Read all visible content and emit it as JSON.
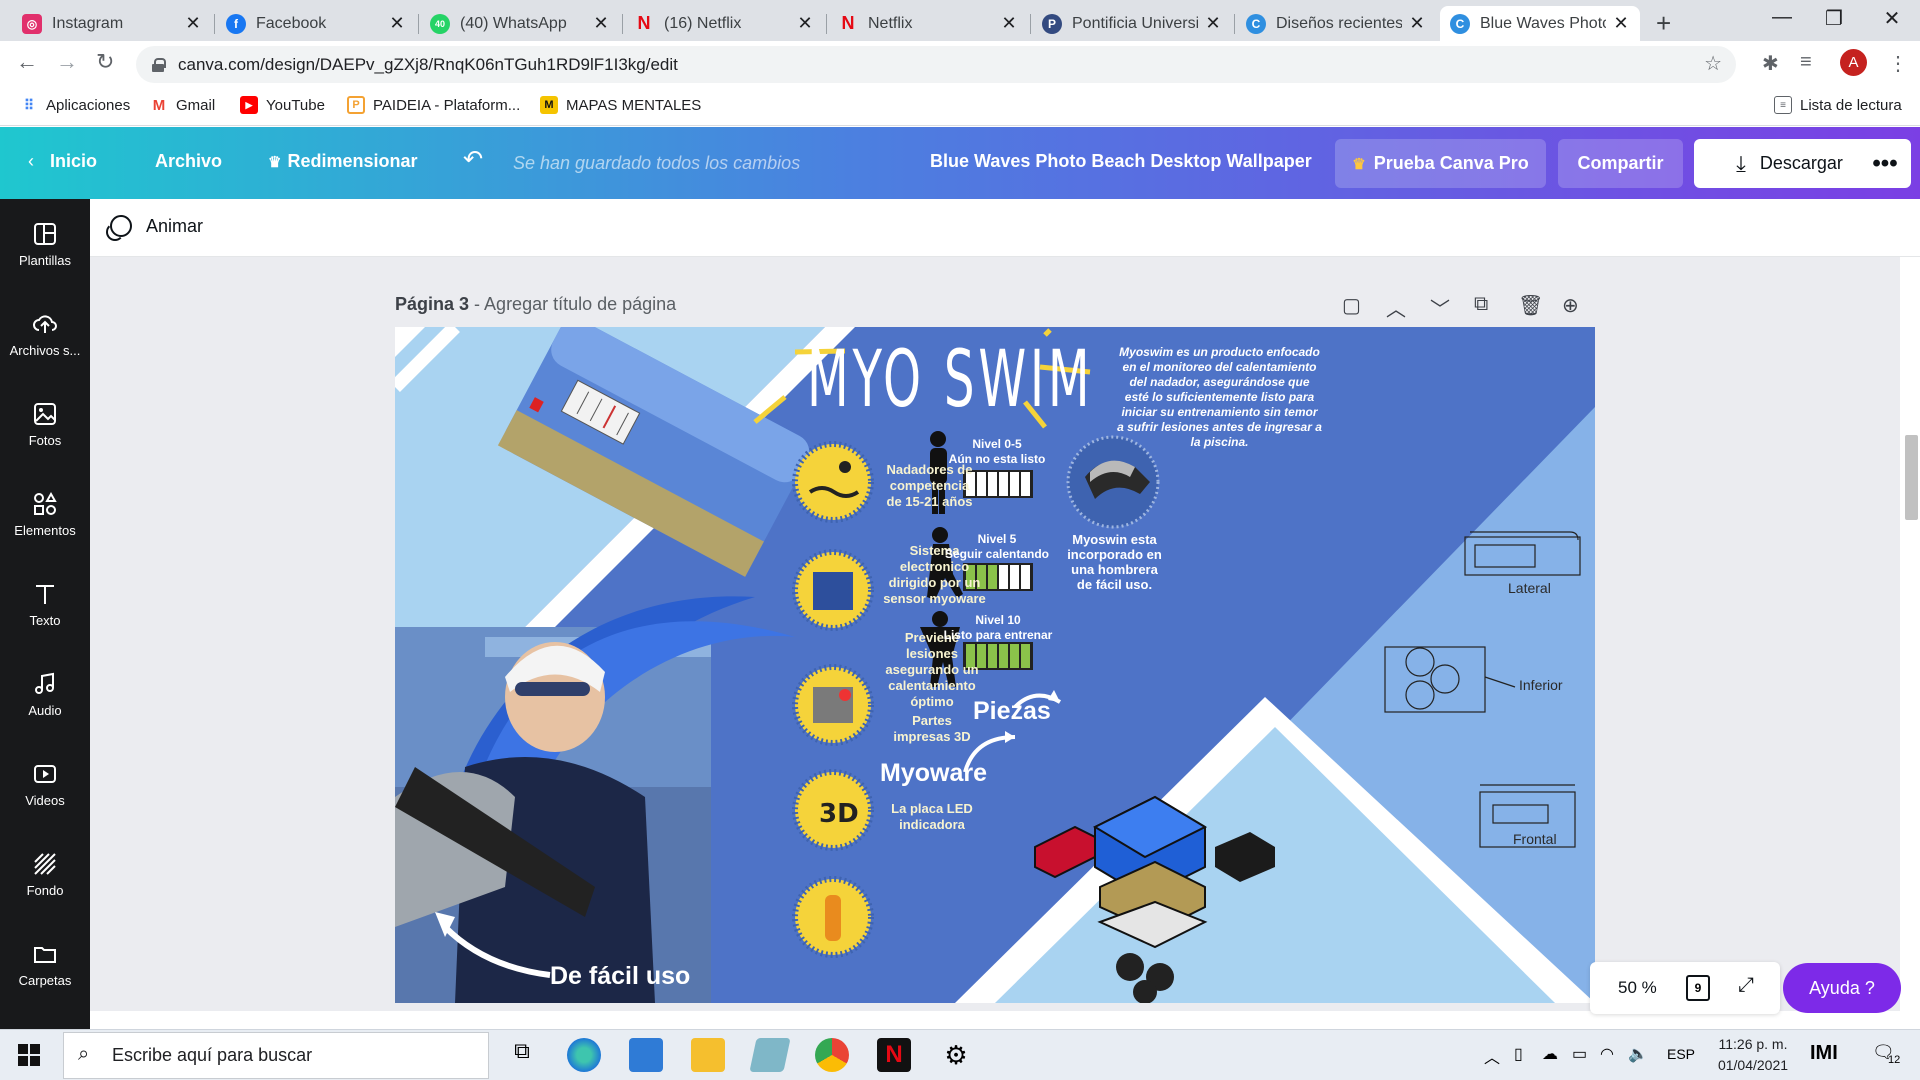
{
  "browser": {
    "tabs": [
      {
        "title": "Instagram",
        "color": "#e1306c",
        "glyph": "◎"
      },
      {
        "title": "Facebook",
        "color": "#1877f2",
        "glyph": "f"
      },
      {
        "title": "(40) WhatsApp",
        "color": "#25d366",
        "glyph": "40"
      },
      {
        "title": "(16) Netflix",
        "color": "#e50914",
        "glyph": "N"
      },
      {
        "title": "Netflix",
        "color": "#e50914",
        "glyph": "N"
      },
      {
        "title": "Pontificia Universid",
        "color": "#334a80",
        "glyph": "P"
      },
      {
        "title": "Diseños recientes",
        "color": "#2f8fe0",
        "glyph": "C"
      },
      {
        "title": "Blue Waves Photo",
        "color": "#2f8fe0",
        "glyph": "C"
      }
    ],
    "url": "canva.com/design/DAEPv_gZXj8/RnqK06nTGuh1RD9lF1I3kg/edit",
    "avatar_letter": "A",
    "bookmarks": [
      {
        "label": "Aplicaciones",
        "color": "#4285f4",
        "glyph": "⋮⋮"
      },
      {
        "label": "Gmail",
        "color": "#ea4335",
        "glyph": "M"
      },
      {
        "label": "YouTube",
        "color": "#ff0000",
        "glyph": "▶"
      },
      {
        "label": "PAIDEIA - Plataform...",
        "color": "#f4a233",
        "glyph": "P"
      },
      {
        "label": "MAPAS MENTALES",
        "color": "#f5c400",
        "glyph": "M"
      }
    ],
    "reading_list": "Lista de lectura"
  },
  "canva_header": {
    "home": "Inicio",
    "file": "Archivo",
    "resize": "Redimensionar",
    "saved_status": "Se han guardado todos los cambios",
    "design_title": "Blue Waves Photo Beach Desktop Wallpaper",
    "try_pro": "Prueba Canva Pro",
    "share": "Compartir",
    "download": "Descargar",
    "more": "•••"
  },
  "sidebar": {
    "items": [
      {
        "label": "Plantillas",
        "icon": "templates-icon"
      },
      {
        "label": "Archivos s...",
        "icon": "upload-icon"
      },
      {
        "label": "Fotos",
        "icon": "photos-icon"
      },
      {
        "label": "Elementos",
        "icon": "elements-icon"
      },
      {
        "label": "Texto",
        "icon": "text-icon"
      },
      {
        "label": "Audio",
        "icon": "audio-icon"
      },
      {
        "label": "Videos",
        "icon": "video-icon"
      },
      {
        "label": "Fondo",
        "icon": "background-icon"
      },
      {
        "label": "Carpetas",
        "icon": "folder-icon"
      }
    ]
  },
  "toolbar": {
    "animate": "Animar"
  },
  "page": {
    "number": "Página 3",
    "separator": " - ",
    "title_placeholder": "Agregar título de página"
  },
  "infographic": {
    "title": "MYO SWIM",
    "description": "Myoswim es un producto enfocado en el monitoreo del calentamiento del nadador, asegurándose que esté lo suficientemente listo para iniciar su entrenamiento sin temor a sufrir lesiones antes de ingresar a la piscina.",
    "features": [
      "Nadadores de competencia de 15-21 años",
      "Sistema electronico dirigido por un sensor myoware",
      "Previene lesiones asegurando un calentamiento óptimo",
      "Partes impresas 3D",
      "La placa LED indicadora"
    ],
    "levels": [
      {
        "line1": "Nivel 0-5",
        "line2": "Aún no esta listo",
        "filled": 0
      },
      {
        "line1": "Nivel 5",
        "line2": "Seguir calentando",
        "filled": 3
      },
      {
        "line1": "Nivel 10",
        "line2": "Listo para entrenar",
        "filled": 6
      }
    ],
    "shoulder_note": "Myoswin esta incorporado en una hombrera de fácil uso.",
    "easy_use": "De fácil uso",
    "parts": "Piezas",
    "myoware": "Myoware",
    "views": [
      "Lateral",
      "Inferior",
      "Frontal"
    ]
  },
  "zoom": {
    "level": "50 %",
    "pages": "9"
  },
  "help": "Ayuda  ?",
  "taskbar": {
    "search_placeholder": "Escribe aquí para buscar",
    "lang": "ESP",
    "time": "11:26 p. m.",
    "date": "01/04/2021",
    "notifications": "12"
  },
  "colors": {
    "canva_gradient_start": "#1fc7cf",
    "canva_gradient_end": "#7b3fe4",
    "help_purple": "#7d2ae8",
    "poster_blue": "#4e73c7",
    "accent_yellow": "#f5d33a",
    "level_green": "#8bc34a"
  }
}
